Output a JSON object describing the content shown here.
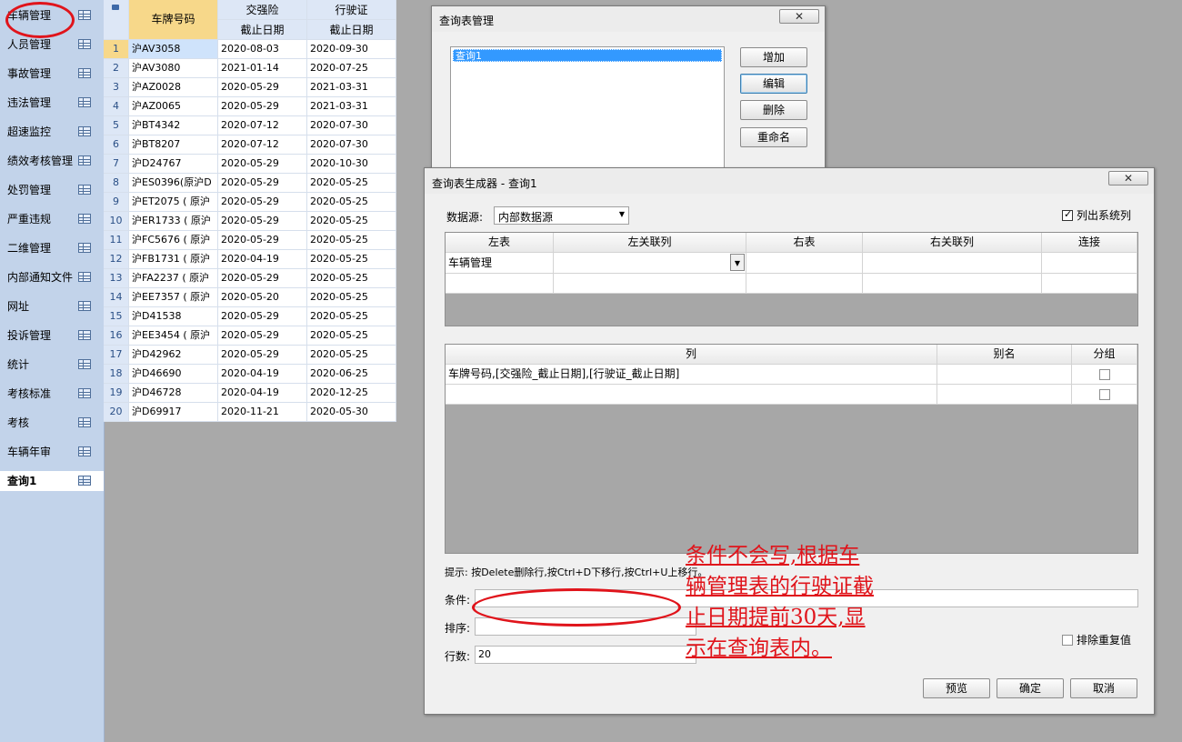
{
  "sidebar": {
    "items": [
      {
        "label": "车辆管理",
        "icon": "table-icon"
      },
      {
        "label": "人员管理",
        "icon": "table-icon"
      },
      {
        "label": "事故管理",
        "icon": "table-icon"
      },
      {
        "label": "违法管理",
        "icon": "table-icon"
      },
      {
        "label": "超速监控",
        "icon": "table-icon"
      },
      {
        "label": "绩效考核管理",
        "icon": "table-icon"
      },
      {
        "label": "处罚管理",
        "icon": "table-icon"
      },
      {
        "label": "严重违规",
        "icon": "table-icon"
      },
      {
        "label": "二维管理",
        "icon": "table-icon"
      },
      {
        "label": "内部通知文件",
        "icon": "table-icon"
      },
      {
        "label": "网址",
        "icon": "table-icon"
      },
      {
        "label": "投诉管理",
        "icon": "table-icon"
      },
      {
        "label": "统计",
        "icon": "table-icon"
      },
      {
        "label": "考核标准",
        "icon": "table-icon"
      },
      {
        "label": "考核",
        "icon": "table-icon"
      },
      {
        "label": "车辆年审",
        "icon": "table-icon"
      },
      {
        "label": "查询1",
        "icon": "table-icon",
        "active": true
      }
    ]
  },
  "grid": {
    "col_plate": "车牌号码",
    "col_insurance": "交强险",
    "col_license": "行驶证",
    "sub_expiry_1": "截止日期",
    "sub_expiry_2": "截止日期",
    "rows": [
      {
        "n": "1",
        "plate": "沪AV3058",
        "ins": "2020-08-03",
        "lic": "2020-09-30"
      },
      {
        "n": "2",
        "plate": "沪AV3080",
        "ins": "2021-01-14",
        "lic": "2020-07-25"
      },
      {
        "n": "3",
        "plate": "沪AZ0028",
        "ins": "2020-05-29",
        "lic": "2021-03-31"
      },
      {
        "n": "4",
        "plate": "沪AZ0065",
        "ins": "2020-05-29",
        "lic": "2021-03-31"
      },
      {
        "n": "5",
        "plate": "沪BT4342",
        "ins": "2020-07-12",
        "lic": "2020-07-30"
      },
      {
        "n": "6",
        "plate": "沪BT8207",
        "ins": "2020-07-12",
        "lic": "2020-07-30"
      },
      {
        "n": "7",
        "plate": "沪D24767",
        "ins": "2020-05-29",
        "lic": "2020-10-30"
      },
      {
        "n": "8",
        "plate": "沪ES0396(原沪D",
        "ins": "2020-05-29",
        "lic": "2020-05-25"
      },
      {
        "n": "9",
        "plate": "沪ET2075 ( 原沪",
        "ins": "2020-05-29",
        "lic": "2020-05-25"
      },
      {
        "n": "10",
        "plate": "沪ER1733 ( 原沪",
        "ins": "2020-05-29",
        "lic": "2020-05-25"
      },
      {
        "n": "11",
        "plate": "沪FC5676 ( 原沪",
        "ins": "2020-05-29",
        "lic": "2020-05-25"
      },
      {
        "n": "12",
        "plate": "沪FB1731 ( 原沪",
        "ins": "2020-04-19",
        "lic": "2020-05-25"
      },
      {
        "n": "13",
        "plate": "沪FA2237 ( 原沪",
        "ins": "2020-05-29",
        "lic": "2020-05-25"
      },
      {
        "n": "14",
        "plate": "沪EE7357 ( 原沪",
        "ins": "2020-05-20",
        "lic": "2020-05-25"
      },
      {
        "n": "15",
        "plate": "沪D41538",
        "ins": "2020-05-29",
        "lic": "2020-05-25"
      },
      {
        "n": "16",
        "plate": "沪EE3454 ( 原沪",
        "ins": "2020-05-29",
        "lic": "2020-05-25"
      },
      {
        "n": "17",
        "plate": "沪D42962",
        "ins": "2020-05-29",
        "lic": "2020-05-25"
      },
      {
        "n": "18",
        "plate": "沪D46690",
        "ins": "2020-04-19",
        "lic": "2020-06-25"
      },
      {
        "n": "19",
        "plate": "沪D46728",
        "ins": "2020-04-19",
        "lic": "2020-12-25"
      },
      {
        "n": "20",
        "plate": "沪D69917",
        "ins": "2020-11-21",
        "lic": "2020-05-30"
      }
    ]
  },
  "query_mgr": {
    "title": "查询表管理",
    "list": [
      "查询1"
    ],
    "add": "增加",
    "edit": "编辑",
    "delete": "删除",
    "rename": "重命名"
  },
  "builder": {
    "title": "查询表生成器 - 查询1",
    "datasource_label": "数据源:",
    "datasource_value": "内部数据源",
    "list_system_cols": "列出系统列",
    "join_headers": [
      "左表",
      "左关联列",
      "右表",
      "右关联列",
      "连接"
    ],
    "join_row_left": "车辆管理",
    "col_headers": [
      "列",
      "别名",
      "分组"
    ],
    "col_row_value": "车牌号码,[交强险_截止日期],[行驶证_截止日期]",
    "hint": "提示: 按Delete删除行,按Ctrl+D下移行,按Ctrl+U上移行。",
    "cond_label": "条件:",
    "sort_label": "排序:",
    "rows_label": "行数:",
    "rows_value": "20",
    "distinct_label": "排除重复值",
    "preview": "预览",
    "ok": "确定",
    "cancel": "取消"
  },
  "annotation": {
    "lines": [
      "条件不会写,根据车",
      "辆管理表的行驶证截",
      "止日期提前30天,显",
      "示在查询表内。"
    ]
  },
  "colors": {
    "annotation": "#e0141b",
    "sidebar_bg": "#c2d3ea",
    "selection": "#3399ff"
  }
}
